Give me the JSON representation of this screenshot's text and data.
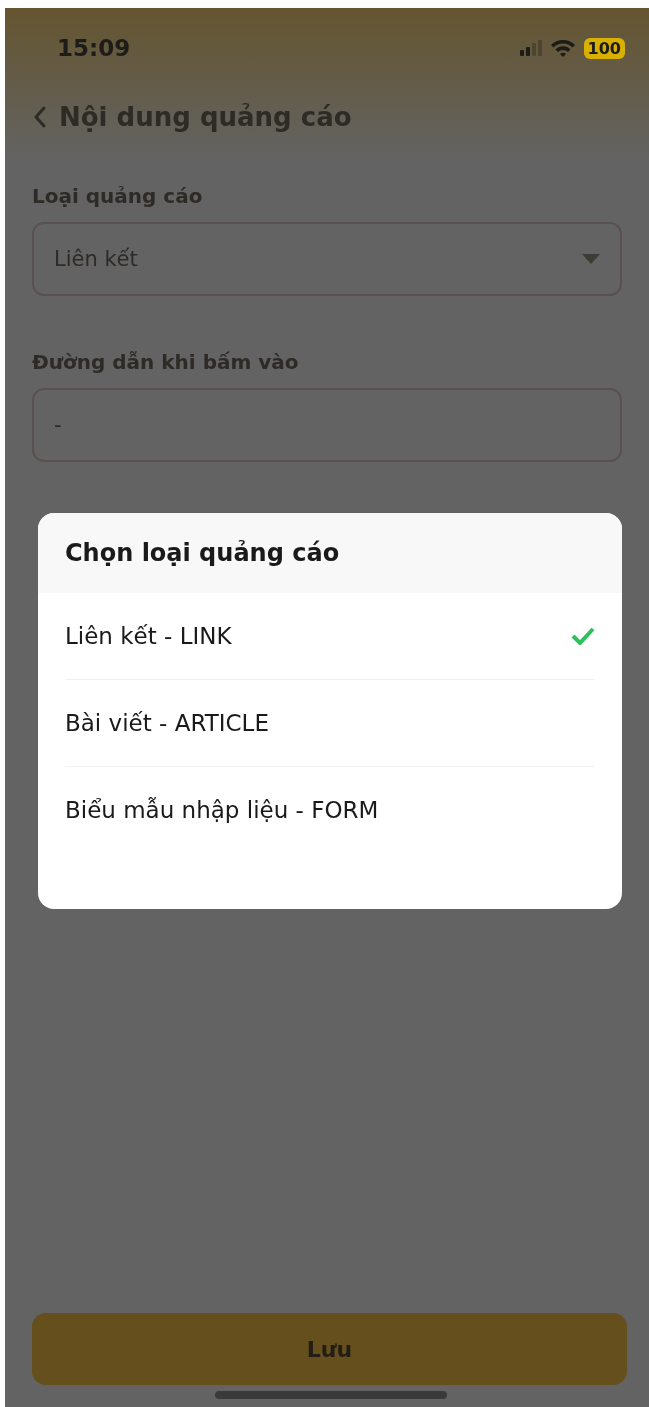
{
  "status_bar": {
    "time": "15:09",
    "battery": "100"
  },
  "header": {
    "title": "Nội dung quảng cáo"
  },
  "fields": [
    {
      "kind": "select",
      "label": "Loại quảng cáo",
      "value": "Liên kết"
    },
    {
      "kind": "text",
      "label": "Đường dẫn khi bấm vào",
      "placeholder": "-"
    }
  ],
  "dialog": {
    "title": "Chọn loại quảng cáo",
    "options": [
      {
        "label": "Liên kết - LINK",
        "selected": true
      },
      {
        "label": "Bài viết - ARTICLE",
        "selected": false
      },
      {
        "label": "Biểu mẫu nhập liệu - FORM",
        "selected": false
      }
    ]
  },
  "save_button": "Lưu"
}
